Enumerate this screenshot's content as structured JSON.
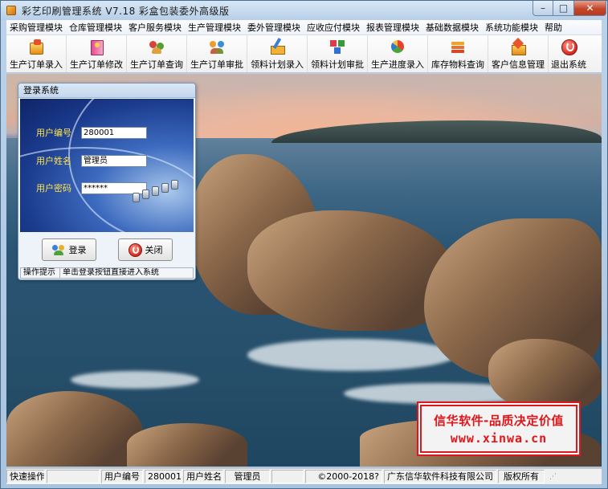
{
  "window": {
    "title": "彩艺印刷管理系统   V7.18 彩盒包装委外高级版",
    "min_symbol": "–",
    "max_symbol": "□",
    "close_symbol": "✕"
  },
  "menu": [
    "采购管理模块",
    "仓库管理模块",
    "客户服务模块",
    "生产管理模块",
    "委外管理模块",
    "应收应付模块",
    "报表管理模块",
    "基础数据模块",
    "系统功能模块",
    "帮助"
  ],
  "toolbar": [
    {
      "label": "生产订单录入",
      "icon": "box-icon"
    },
    {
      "label": "生产订单修改",
      "icon": "book-icon"
    },
    {
      "label": "生产订单查询",
      "icon": "people-icon"
    },
    {
      "label": "生产订单审批",
      "icon": "crowd-icon"
    },
    {
      "label": "领料计划录入",
      "icon": "pencil-icon"
    },
    {
      "label": "领料计划审批",
      "icon": "cubes-icon"
    },
    {
      "label": "生产进度录入",
      "icon": "pie-chart-icon"
    },
    {
      "label": "库存物料查询",
      "icon": "stack-icon"
    },
    {
      "label": "客户信息管理",
      "icon": "house-icon"
    },
    {
      "label": "退出系统",
      "icon": "power-icon"
    }
  ],
  "login": {
    "title": "登录系统",
    "user_code_label": "用户编号",
    "user_code_value": "280001",
    "user_name_label": "用户姓名",
    "user_name_value": "管理员",
    "password_label": "用户密码",
    "password_value": "******",
    "login_button": "登录",
    "close_button": "关闭",
    "hint_label": "操作提示",
    "hint_text": "单击登录按钮直接进入系统"
  },
  "promo": {
    "line1": "信华软件-品质决定价值",
    "line2": "www.xinwa.cn"
  },
  "statusbar": {
    "quick_ops": "快速操作",
    "user_code_label": "用户编号",
    "user_code": "280001",
    "user_name_label": "用户姓名",
    "user_name": "管理员",
    "copyright_years": "©2000-2018?",
    "company": "广东信华软件科技有限公司",
    "rights": "版权所有"
  },
  "colors": {
    "promo_red": "#e0161a",
    "label_yellow": "#ffe44a"
  }
}
